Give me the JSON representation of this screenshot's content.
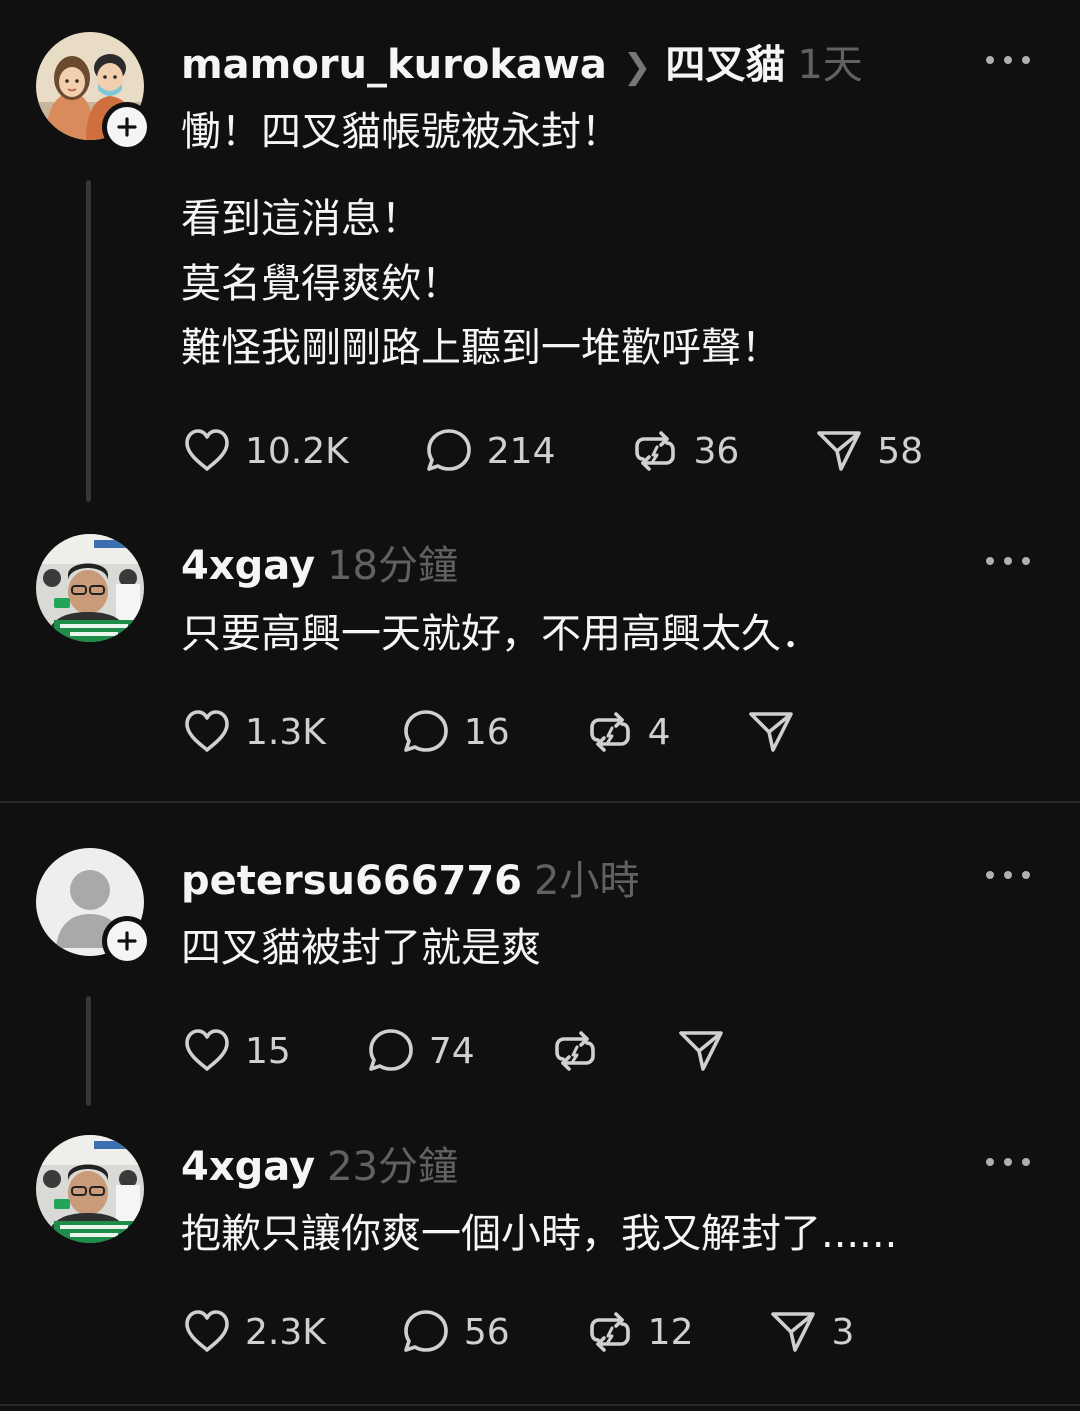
{
  "posts": [
    {
      "username": "mamoru_kurokawa",
      "topic": "四叉貓",
      "time": "1天",
      "headline": "慟！四叉貓帳號被永封！",
      "lines": [
        "看到這消息！",
        "莫名覺得爽欸！",
        "難怪我剛剛路上聽到一堆歡呼聲！"
      ],
      "likes": "10.2K",
      "replies": "214",
      "reposts": "36",
      "shares": "58"
    },
    {
      "username": "4xgay",
      "time": "18分鐘",
      "text": "只要高興一天就好，不用高興太久．",
      "likes": "1.3K",
      "replies": "16",
      "reposts": "4",
      "shares": ""
    },
    {
      "username": "petersu666776",
      "time": "2小時",
      "text": "四叉貓被封了就是爽",
      "likes": "15",
      "replies": "74",
      "reposts": "",
      "shares": ""
    },
    {
      "username": "4xgay",
      "time": "23分鐘",
      "text": "抱歉只讓你爽一個小時，我又解封了......",
      "likes": "2.3K",
      "replies": "56",
      "reposts": "12",
      "shares": "3"
    }
  ],
  "colors": {
    "background": "#101010",
    "text": "#f3f5f7",
    "muted": "#616161",
    "thread_line": "#333638",
    "divider": "#2a2a2a"
  },
  "icons": [
    "heart-icon",
    "comment-icon",
    "repost-icon",
    "share-icon",
    "more-icon",
    "plus-icon"
  ]
}
